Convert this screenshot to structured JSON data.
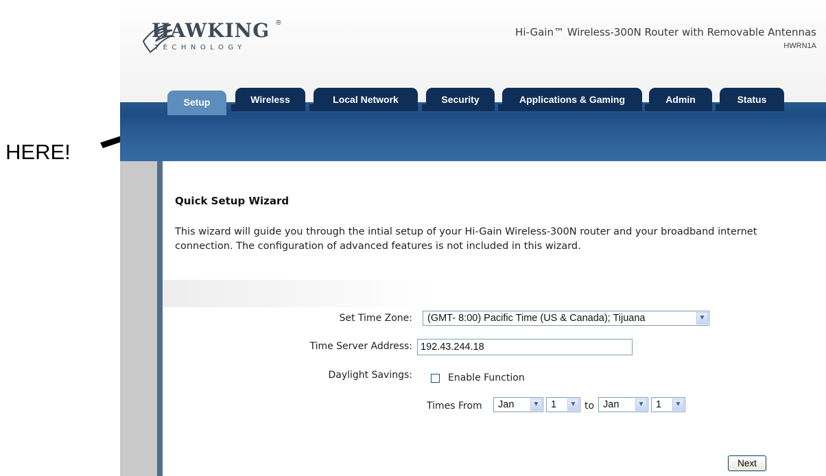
{
  "annotation": {
    "text": "HERE!"
  },
  "header": {
    "logo_word": "HAWKING",
    "logo_sub": "TECHNOLOGY",
    "logo_reg": "®",
    "product_title": "Hi-Gain™ Wireless-300N Router with Removable Antennas",
    "model": "HWRN1A"
  },
  "tabs": [
    {
      "label": "Setup",
      "active": true
    },
    {
      "label": "Wireless",
      "active": false
    },
    {
      "label": "Local Network",
      "active": false
    },
    {
      "label": "Security",
      "active": false
    },
    {
      "label": "Applications & Gaming",
      "active": false
    },
    {
      "label": "Admin",
      "active": false
    },
    {
      "label": "Status",
      "active": false
    }
  ],
  "content": {
    "title": "Quick Setup Wizard",
    "intro": "This wizard will guide you through the intial setup of your Hi-Gain Wireless-300N router and your broadband internet connection. The configuration of advanced features is not included in this wizard."
  },
  "form": {
    "time_zone_label": "Set Time Zone:",
    "time_zone_value": "(GMT- 8:00) Pacific Time (US & Canada); Tijuana",
    "time_server_label": "Time Server Address:",
    "time_server_value": "192.43.244.18",
    "daylight_label": "Daylight Savings:",
    "enable_label": "Enable Function",
    "enable_checked": false,
    "times_from_label": "Times From",
    "from_month": "Jan",
    "from_day": "1",
    "to_label": "to",
    "to_month": "Jan",
    "to_day": "1",
    "next_label": "Next"
  },
  "colors": {
    "nav_bar": "#1e4d84",
    "tab_inactive": "#0f2e58",
    "tab_active": "#5d8dbc",
    "sidebar": "#c9c9c9"
  }
}
